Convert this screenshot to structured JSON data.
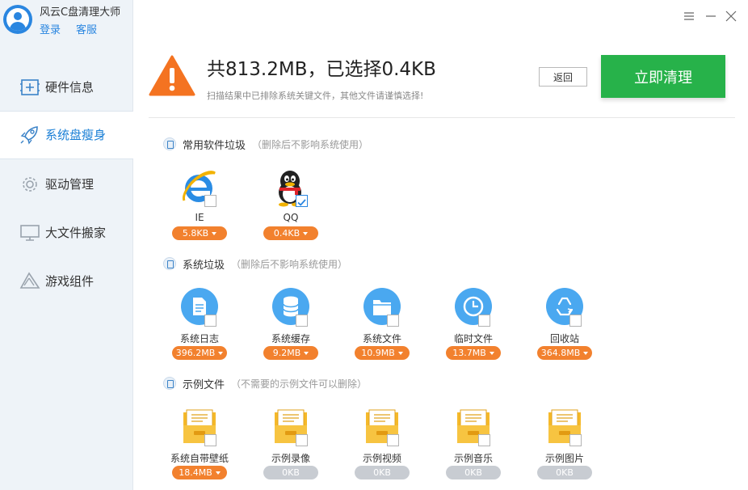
{
  "app": {
    "name": "风云C盘清理大师",
    "login": "登录",
    "service": "客服"
  },
  "sidebar": {
    "items": [
      {
        "label": "硬件信息",
        "icon": "hardware-icon"
      },
      {
        "label": "系统盘瘦身",
        "icon": "rocket-icon"
      },
      {
        "label": "驱动管理",
        "icon": "gear-icon"
      },
      {
        "label": "大文件搬家",
        "icon": "monitor-icon"
      },
      {
        "label": "游戏组件",
        "icon": "game-icon"
      }
    ],
    "active_index": 1
  },
  "header": {
    "title": "共813.2MB，已选择0.4KB",
    "subtitle": "扫描结果中已排除系统关键文件，其他文件请谨慎选择!",
    "back_label": "返回",
    "clean_label": "立即清理"
  },
  "sections": [
    {
      "title": "常用软件垃圾",
      "note": "（删除后不影响系统使用）",
      "items": [
        {
          "name": "IE",
          "size": "5.8KB",
          "icon": "ie-icon",
          "checked": false
        },
        {
          "name": "QQ",
          "size": "0.4KB",
          "icon": "qq-penguin-icon",
          "checked": true
        }
      ]
    },
    {
      "title": "系统垃圾",
      "note": "（删除后不影响系统使用）",
      "items": [
        {
          "name": "系统日志",
          "size": "396.2MB",
          "icon": "document-icon",
          "checked": false
        },
        {
          "name": "系统缓存",
          "size": "9.2MB",
          "icon": "database-icon",
          "checked": false
        },
        {
          "name": "系统文件",
          "size": "10.9MB",
          "icon": "folder-icon",
          "checked": false
        },
        {
          "name": "临时文件",
          "size": "13.7MB",
          "icon": "clock-icon",
          "checked": false
        },
        {
          "name": "回收站",
          "size": "364.8MB",
          "icon": "recycle-icon",
          "checked": false
        }
      ]
    },
    {
      "title": "示例文件",
      "note": "（不需要的示例文件可以删除）",
      "items": [
        {
          "name": "系统自带壁纸",
          "size": "18.4MB",
          "icon": "archive-folder-icon",
          "checked": false
        },
        {
          "name": "示例录像",
          "size": "0KB",
          "icon": "archive-folder-icon",
          "checked": false
        },
        {
          "name": "示例视频",
          "size": "0KB",
          "icon": "archive-folder-icon",
          "checked": false
        },
        {
          "name": "示例音乐",
          "size": "0KB",
          "icon": "archive-folder-icon",
          "checked": false
        },
        {
          "name": "示例图片",
          "size": "0KB",
          "icon": "archive-folder-icon",
          "checked": false
        }
      ]
    }
  ],
  "colors": {
    "accent": "#2a86e0",
    "clean_button": "#27b24a",
    "size_badge": "#f2812e",
    "size_badge_empty": "#c8ccd2",
    "warning": "#f47321"
  }
}
